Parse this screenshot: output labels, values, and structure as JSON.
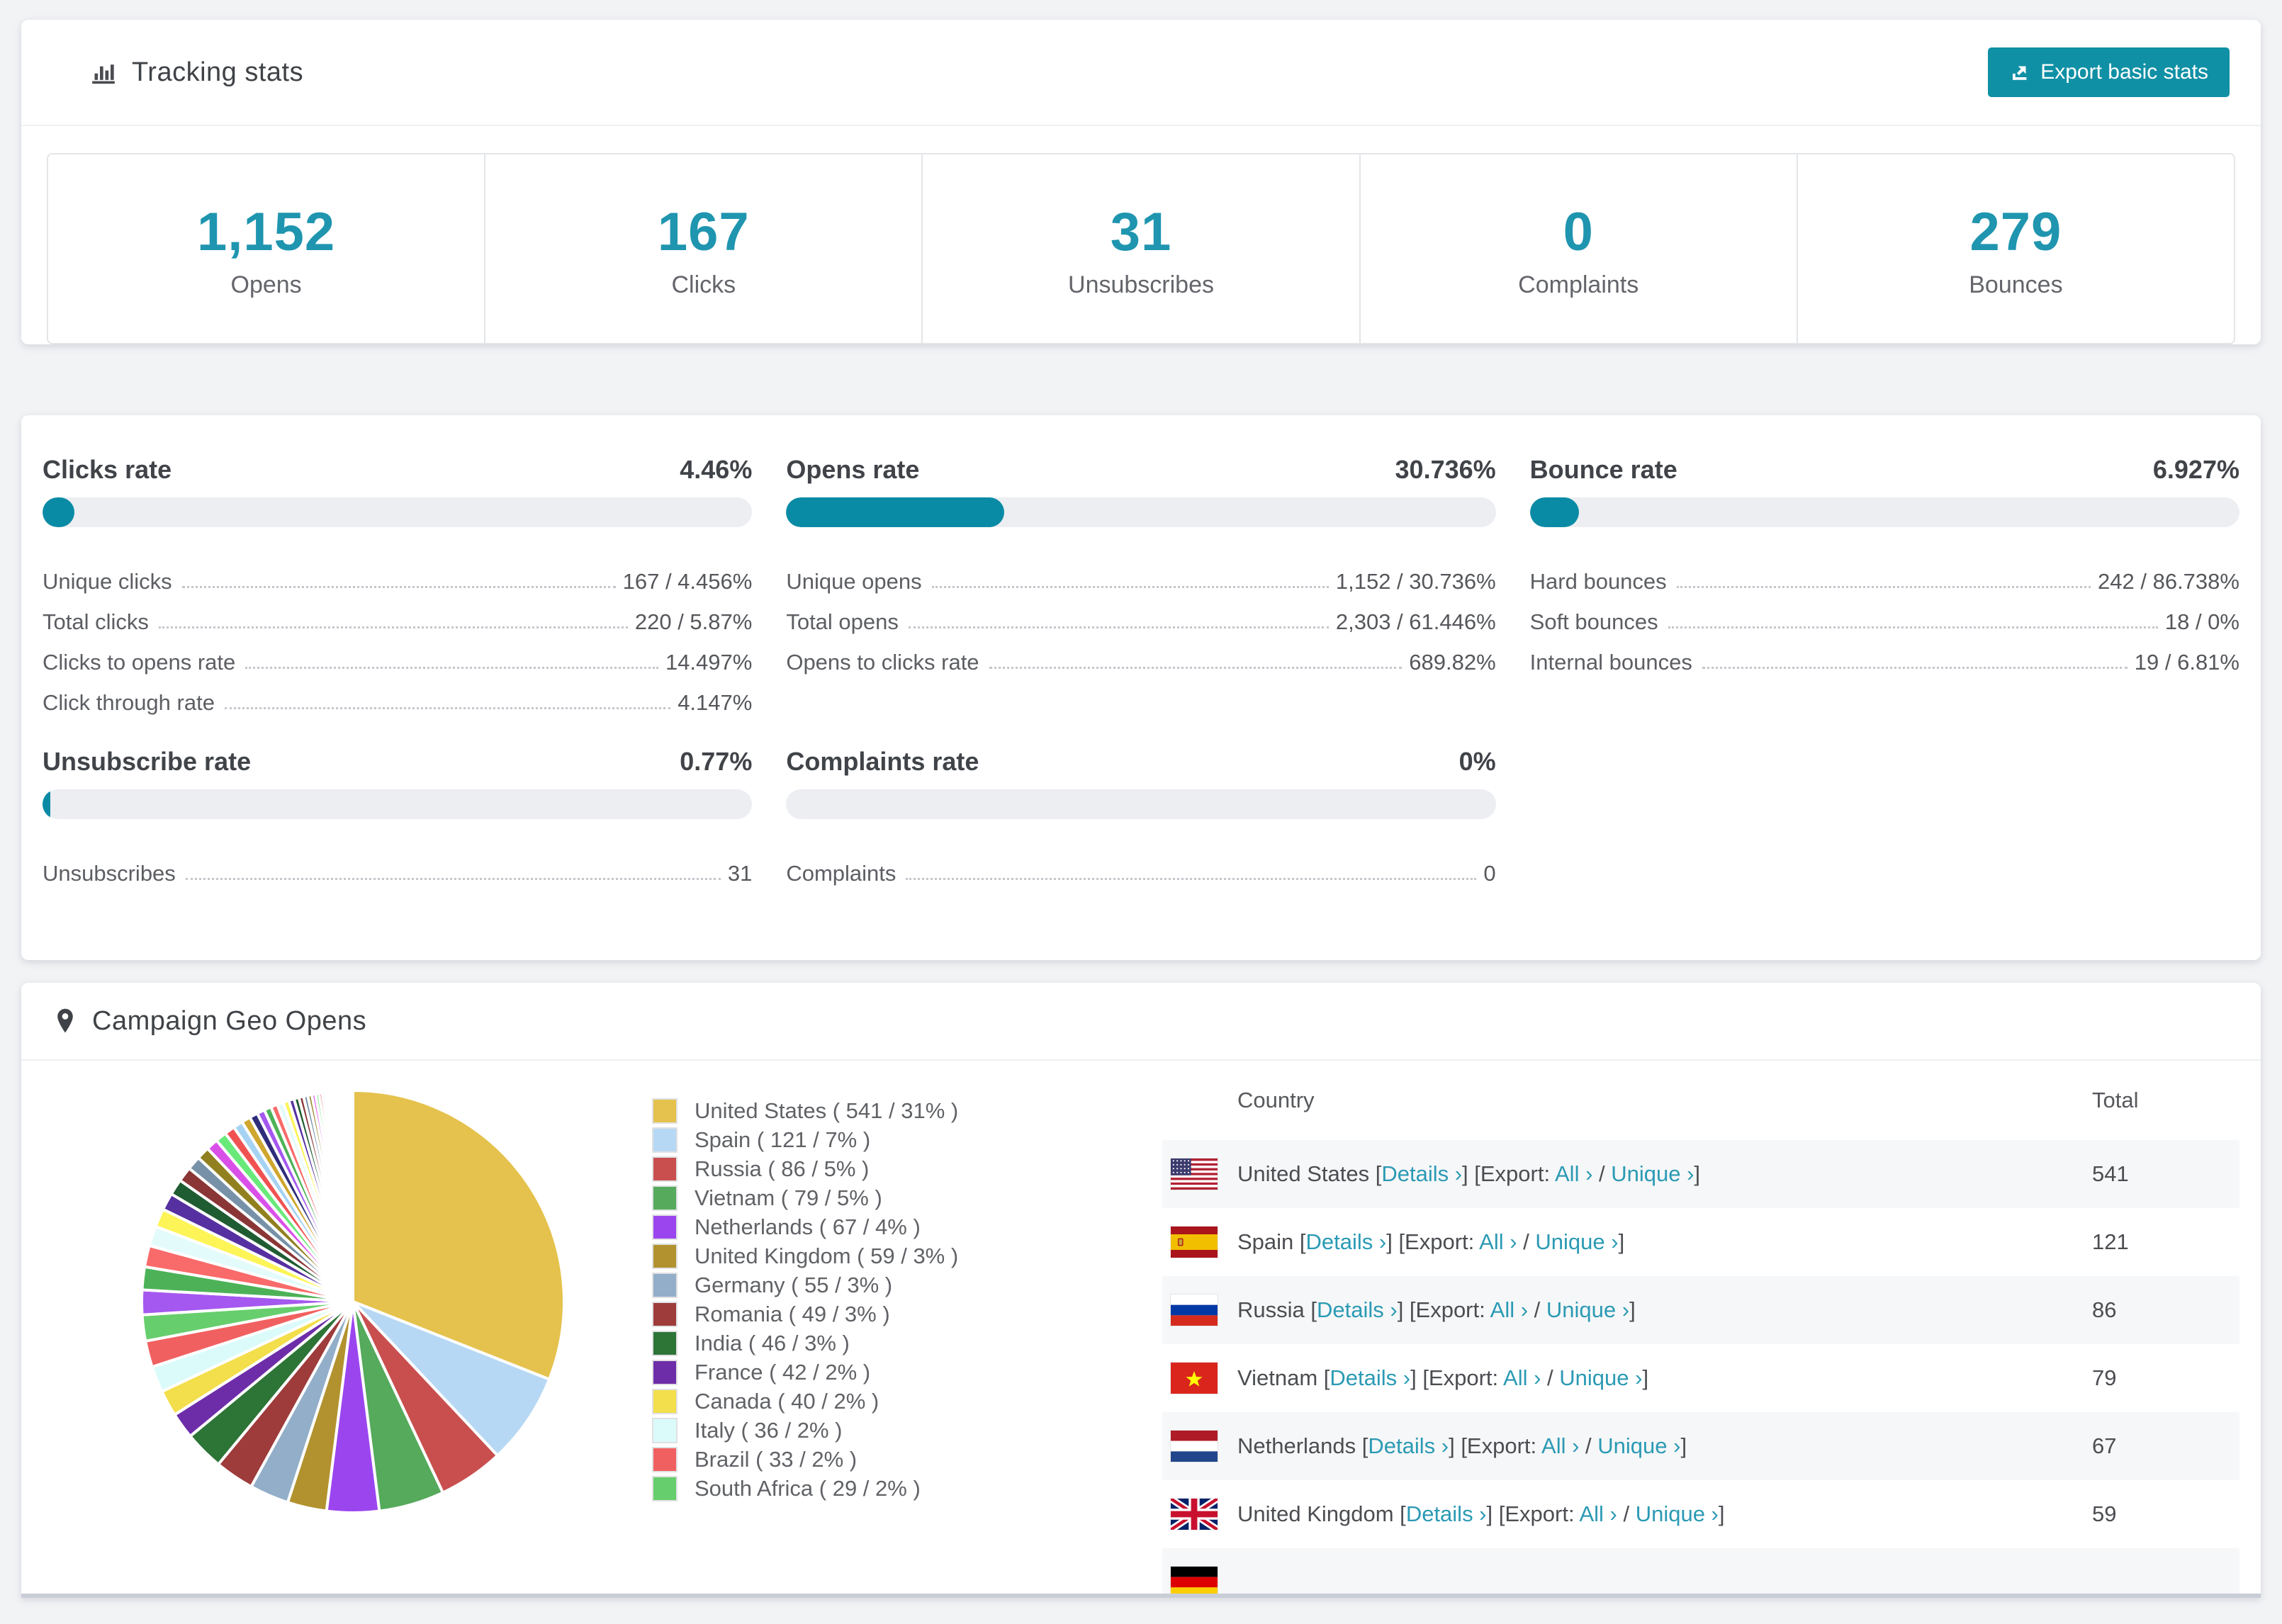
{
  "colors": {
    "accent_teal": "#1090a5",
    "bar_fill": "#0a8ba5",
    "stat_number": "#1f95af",
    "link": "#2b9ab4",
    "panel_bg": "#ffffff",
    "page_bg": "#f2f3f5",
    "striped_row": "#f6f7f8"
  },
  "tracking": {
    "title": "Tracking stats",
    "icon": "bar-chart-icon",
    "export_label": "Export basic stats",
    "stats": [
      {
        "value": "1,152",
        "label": "Opens"
      },
      {
        "value": "167",
        "label": "Clicks"
      },
      {
        "value": "31",
        "label": "Unsubscribes"
      },
      {
        "value": "0",
        "label": "Complaints"
      },
      {
        "value": "279",
        "label": "Bounces"
      }
    ]
  },
  "rates": {
    "top_sections": [
      {
        "title": "Clicks rate",
        "pct_label": "4.46%",
        "pct": 4.46,
        "rows": [
          {
            "label": "Unique clicks",
            "value": "167 / 4.456%"
          },
          {
            "label": "Total clicks",
            "value": "220 / 5.87%"
          },
          {
            "label": "Clicks to opens rate",
            "value": "14.497%"
          },
          {
            "label": "Click through rate",
            "value": "4.147%"
          }
        ]
      },
      {
        "title": "Opens rate",
        "pct_label": "30.736%",
        "pct": 30.736,
        "rows": [
          {
            "label": "Unique opens",
            "value": "1,152 / 30.736%"
          },
          {
            "label": "Total opens",
            "value": "2,303 / 61.446%"
          },
          {
            "label": "Opens to clicks rate",
            "value": "689.82%"
          }
        ]
      },
      {
        "title": "Bounce rate",
        "pct_label": "6.927%",
        "pct": 6.927,
        "rows": [
          {
            "label": "Hard bounces",
            "value": "242 / 86.738%"
          },
          {
            "label": "Soft bounces",
            "value": "18 / 0%"
          },
          {
            "label": "Internal bounces",
            "value": "19 / 6.81%"
          }
        ]
      }
    ],
    "bottom_sections": [
      {
        "title": "Unsubscribe rate",
        "pct_label": "0.77%",
        "pct": 0.77,
        "rows": [
          {
            "label": "Unsubscribes",
            "value": "31"
          }
        ]
      },
      {
        "title": "Complaints rate",
        "pct_label": "0%",
        "pct": 0,
        "rows": [
          {
            "label": "Complaints",
            "value": "0"
          }
        ]
      }
    ]
  },
  "geo": {
    "title": "Campaign Geo Opens",
    "icon": "map-pin-icon",
    "columns": {
      "country": "Country",
      "total": "Total"
    },
    "links": {
      "details": "Details ›",
      "export_label": "Export:",
      "all": "All ›",
      "unique": "Unique ›",
      "open_bracket": "[",
      "close_bracket": "]",
      "slash": "/"
    },
    "rows": [
      {
        "flag": "us",
        "country": "United States",
        "total": "541"
      },
      {
        "flag": "es",
        "country": "Spain",
        "total": "121"
      },
      {
        "flag": "ru",
        "country": "Russia",
        "total": "86"
      },
      {
        "flag": "vn",
        "country": "Vietnam",
        "total": "79"
      },
      {
        "flag": "nl",
        "country": "Netherlands",
        "total": "67"
      },
      {
        "flag": "gb",
        "country": "United Kingdom",
        "total": "59"
      },
      {
        "flag": "de",
        "country": "",
        "total": "",
        "partial": true
      }
    ]
  },
  "chart_data": {
    "type": "pie",
    "title": "Campaign Geo Opens",
    "unit": "opens",
    "legend_position": "right",
    "slices": [
      {
        "label": "United States",
        "value": 541,
        "pct": 31,
        "color": "#e5c24d"
      },
      {
        "label": "Spain",
        "value": 121,
        "pct": 7,
        "color": "#b7d8f4"
      },
      {
        "label": "Russia",
        "value": 86,
        "pct": 5,
        "color": "#c94f4f"
      },
      {
        "label": "Vietnam",
        "value": 79,
        "pct": 5,
        "color": "#55aa5c"
      },
      {
        "label": "Netherlands",
        "value": 67,
        "pct": 4,
        "color": "#9b45ef"
      },
      {
        "label": "United Kingdom",
        "value": 59,
        "pct": 3,
        "color": "#b2922f"
      },
      {
        "label": "Germany",
        "value": 55,
        "pct": 3,
        "color": "#92aec9"
      },
      {
        "label": "Romania",
        "value": 49,
        "pct": 3,
        "color": "#9e3b3b"
      },
      {
        "label": "India",
        "value": 46,
        "pct": 3,
        "color": "#2d7437"
      },
      {
        "label": "France",
        "value": 42,
        "pct": 2,
        "color": "#6e2da8"
      },
      {
        "label": "Canada",
        "value": 40,
        "pct": 2,
        "color": "#f3de4b"
      },
      {
        "label": "Italy",
        "value": 36,
        "pct": 2,
        "color": "#dbfbfb"
      },
      {
        "label": "Brazil",
        "value": 33,
        "pct": 2,
        "color": "#f16060"
      },
      {
        "label": "South Africa",
        "value": 29,
        "pct": 2,
        "color": "#67ce6d"
      }
    ],
    "others": {
      "note": "remaining small unlabeled countries",
      "total_pct": 26,
      "count": 46,
      "ratio": 0.93,
      "palette": [
        "#a558ef",
        "#4db257",
        "#f96a6a",
        "#e4fbfb",
        "#fdf457",
        "#5630a0",
        "#205c31",
        "#8a3636",
        "#7792a8",
        "#91801f",
        "#d950e8",
        "#69e97a",
        "#f05252",
        "#a6d3f3",
        "#cfa62e",
        "#2f2d7a"
      ]
    }
  }
}
